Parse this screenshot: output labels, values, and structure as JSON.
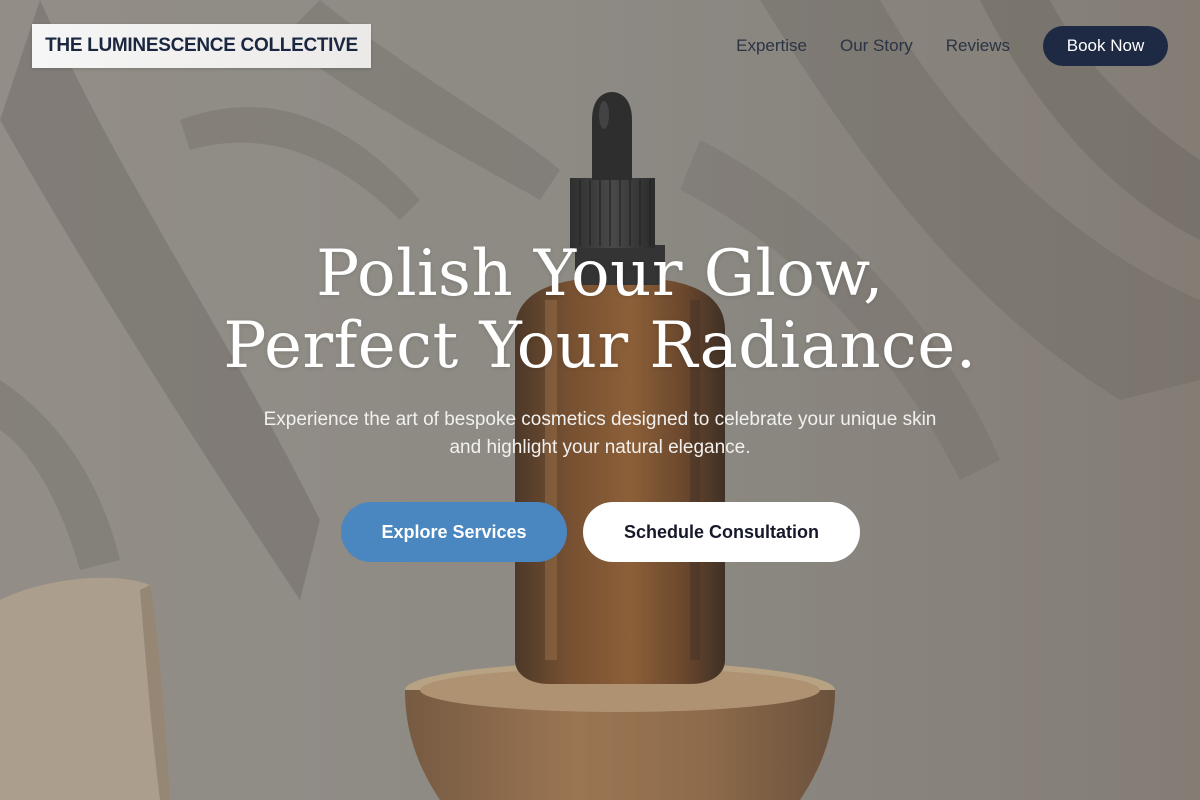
{
  "header": {
    "brand": "THE LUMINESCENCE COLLECTIVE",
    "nav": [
      {
        "label": "Expertise"
      },
      {
        "label": "Our Story"
      },
      {
        "label": "Reviews"
      }
    ],
    "cta_label": "Book Now"
  },
  "hero": {
    "headline_line1": "Polish Your Glow,",
    "headline_line2": "Perfect Your Radiance.",
    "subheadline": "Experience the art of bespoke cosmetics designed to celebrate your unique skin and highlight your natural elegance.",
    "primary_button": "Explore Services",
    "secondary_button": "Schedule Consultation",
    "image_icon": "serum-bottle-photo"
  },
  "colors": {
    "brand_navy": "#1e2a44",
    "primary_blue": "#4a86bf",
    "white": "#ffffff"
  }
}
